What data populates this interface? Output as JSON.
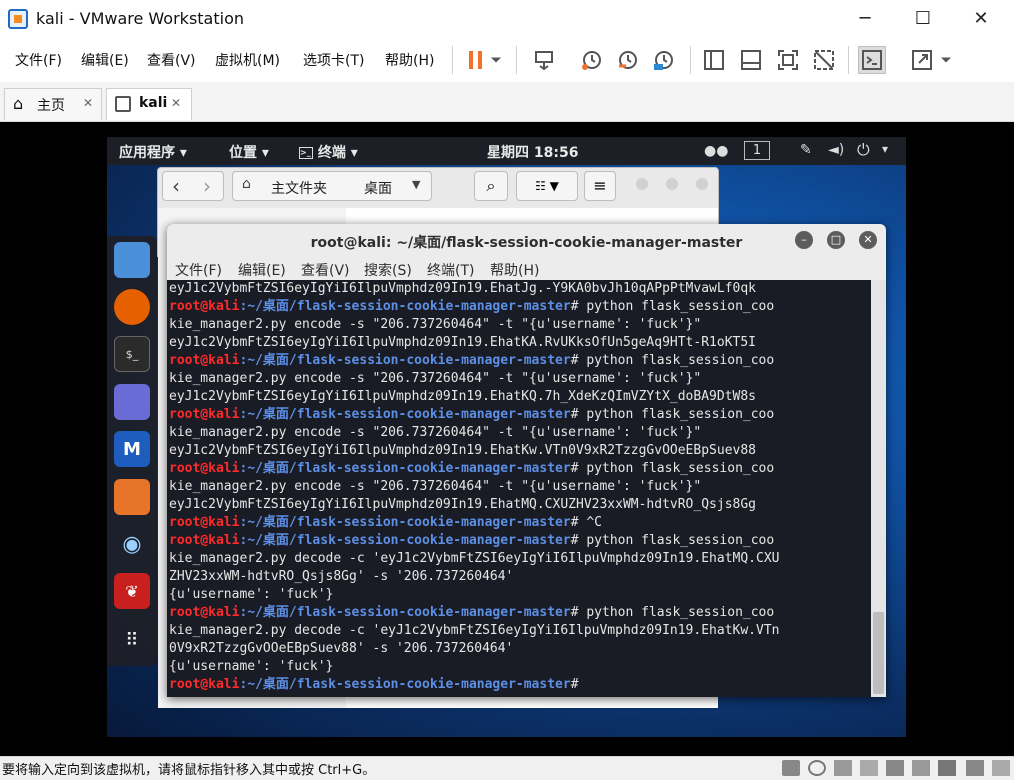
{
  "window": {
    "title": "kali - VMware Workstation",
    "minimize_glyph": "─",
    "maximize_glyph": "☐",
    "close_glyph": "✕"
  },
  "menu": {
    "items": [
      "文件(F)",
      "编辑(E)",
      "查看(V)",
      "虚拟机(M)",
      "选项卡(T)",
      "帮助(H)"
    ]
  },
  "toolbar": {
    "icons": [
      "pause-icon",
      "dropdown-icon",
      "send-keys-icon",
      "snapshot-icon",
      "revert-snapshot-icon",
      "snapshot-manager-icon",
      "sidebar-icon",
      "thumbnail-icon",
      "fullscreen-icon",
      "unity-icon",
      "console-icon",
      "stretch-icon"
    ],
    "accent": "#f0712c"
  },
  "tabs": [
    {
      "label": "主页",
      "icon": "home-icon",
      "close": "✕"
    },
    {
      "label": "kali",
      "icon": "vm-icon",
      "close": "✕"
    }
  ],
  "gnome": {
    "applications": "应用程序 ▾",
    "places": "位置 ▾",
    "terminal": "终端 ▾",
    "clock": "星期四 18:56",
    "workspace": "1"
  },
  "files": {
    "back": "‹",
    "forward": "›",
    "home_label": "主文件夹",
    "desktop_label": "桌面"
  },
  "terminal": {
    "title": "root@kali: ~/桌面/flask-session-cookie-manager-master",
    "menu": [
      "文件(F)",
      "编辑(E)",
      "查看(V)",
      "搜索(S)",
      "终端(T)",
      "帮助(H)"
    ],
    "prompt_user": "root@kali",
    "prompt_path": ":~/桌面/flask-session-cookie-manager-master",
    "lines": [
      {
        "type": "out",
        "text": "eyJ1c2VybmFtZSI6eyIgYiI6IlpuVmphdz09In19.EhatJg.-Y9KA0bvJh10qAPpPtMvawLf0qk"
      },
      {
        "type": "prompt",
        "text": "# python flask_session_coo"
      },
      {
        "type": "out",
        "text": "kie_manager2.py encode -s \"206.737260464\" -t \"{u'username': 'fuck'}\""
      },
      {
        "type": "out",
        "text": "eyJ1c2VybmFtZSI6eyIgYiI6IlpuVmphdz09In19.EhatKA.RvUKksOfUn5geAq9HTt-R1oKT5I"
      },
      {
        "type": "prompt",
        "text": "# python flask_session_coo"
      },
      {
        "type": "out",
        "text": "kie_manager2.py encode -s \"206.737260464\" -t \"{u'username': 'fuck'}\""
      },
      {
        "type": "out",
        "text": "eyJ1c2VybmFtZSI6eyIgYiI6IlpuVmphdz09In19.EhatKQ.7h_XdeKzQImVZYtX_doBA9DtW8s"
      },
      {
        "type": "prompt",
        "text": "# python flask_session_coo"
      },
      {
        "type": "out",
        "text": "kie_manager2.py encode -s \"206.737260464\" -t \"{u'username': 'fuck'}\""
      },
      {
        "type": "out",
        "text": "eyJ1c2VybmFtZSI6eyIgYiI6IlpuVmphdz09In19.EhatKw.VTn0V9xR2TzzgGvOOeEBpSuev88"
      },
      {
        "type": "prompt",
        "text": "# python flask_session_coo"
      },
      {
        "type": "out",
        "text": "kie_manager2.py encode -s \"206.737260464\" -t \"{u'username': 'fuck'}\""
      },
      {
        "type": "out",
        "text": "eyJ1c2VybmFtZSI6eyIgYiI6IlpuVmphdz09In19.EhatMQ.CXUZHV23xxWM-hdtvRO_Qsjs8Gg"
      },
      {
        "type": "prompt",
        "text": "# ^C"
      },
      {
        "type": "prompt",
        "text": "# python flask_session_coo"
      },
      {
        "type": "out",
        "text": "kie_manager2.py decode -c 'eyJ1c2VybmFtZSI6eyIgYiI6IlpuVmphdz09In19.EhatMQ.CXU"
      },
      {
        "type": "out",
        "text": "ZHV23xxWM-hdtvRO_Qsjs8Gg' -s '206.737260464'"
      },
      {
        "type": "out",
        "text": "{u'username': 'fuck'}"
      },
      {
        "type": "prompt",
        "text": "# python flask_session_coo"
      },
      {
        "type": "out",
        "text": "kie_manager2.py decode -c 'eyJ1c2VybmFtZSI6eyIgYiI6IlpuVmphdz09In19.EhatKw.VTn"
      },
      {
        "type": "out",
        "text": "0V9xR2TzzgGvOOeEBpSuev88' -s '206.737260464'"
      },
      {
        "type": "out",
        "text": "{u'username': 'fuck'}"
      },
      {
        "type": "prompt",
        "text": "# "
      }
    ]
  },
  "status": {
    "text": "要将输入定向到该虚拟机，请将鼠标指针移入其中或按 Ctrl+G。"
  }
}
